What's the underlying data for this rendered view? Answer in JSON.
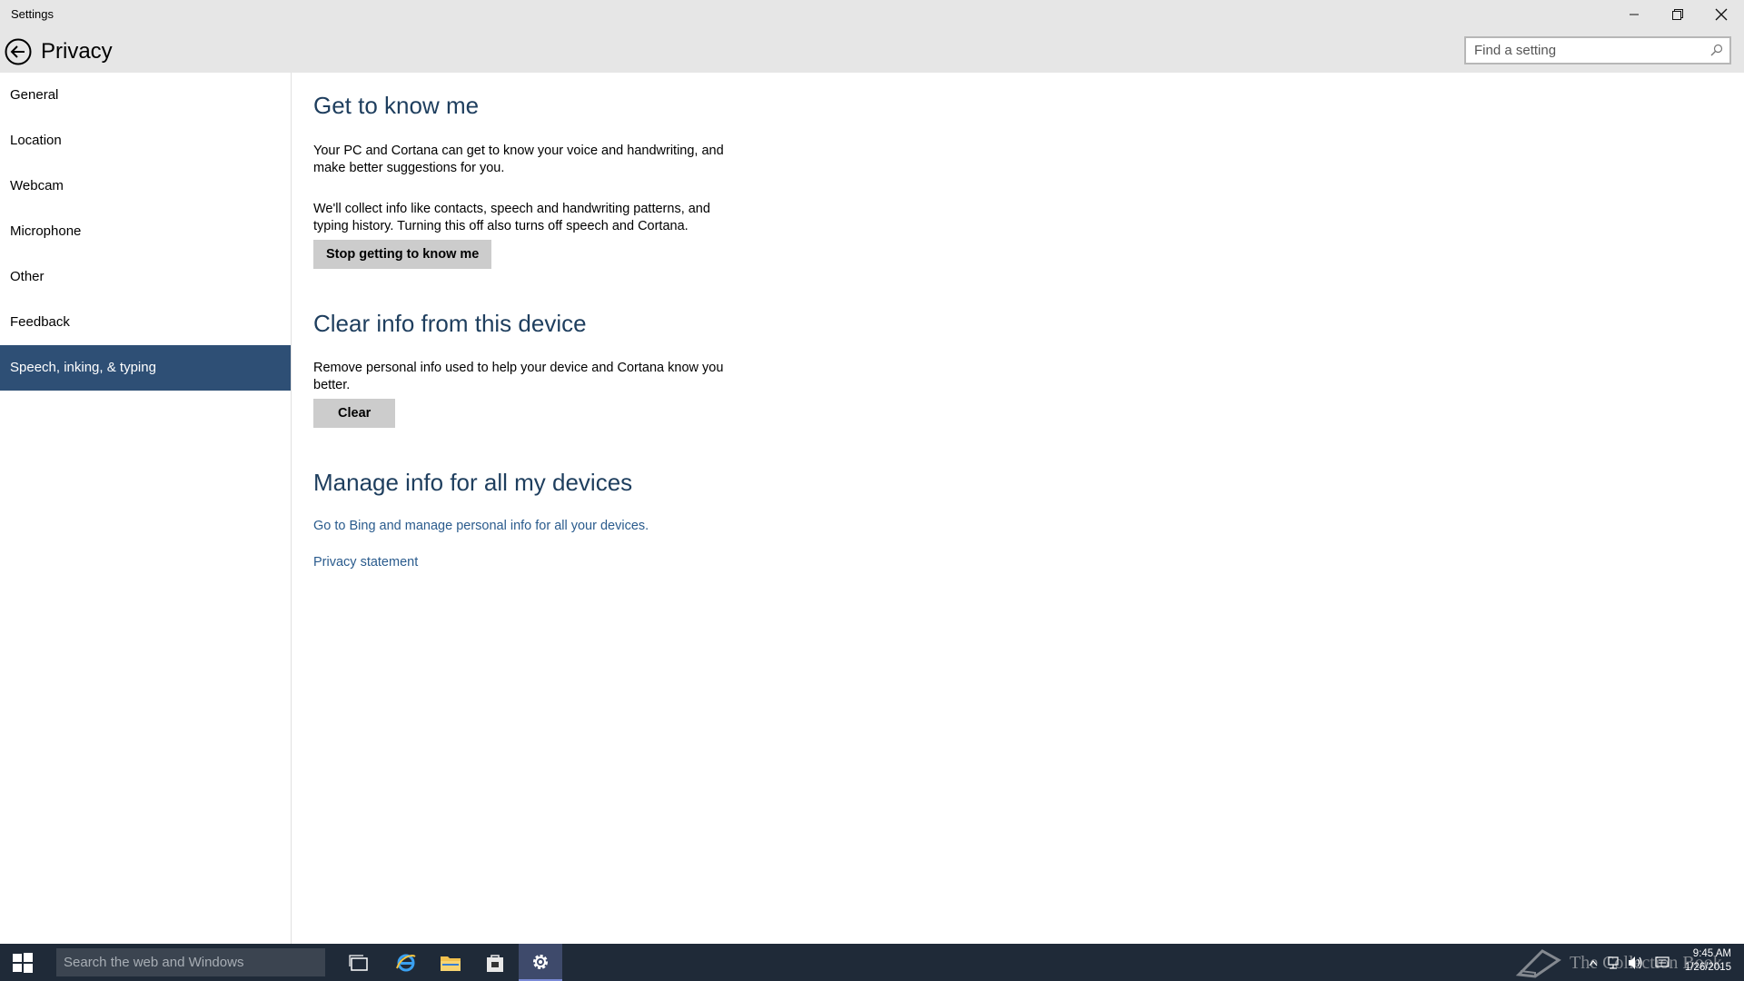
{
  "window": {
    "title": "Settings"
  },
  "header": {
    "title": "Privacy",
    "search_placeholder": "Find a setting"
  },
  "sidebar": {
    "items": [
      {
        "label": "General"
      },
      {
        "label": "Location"
      },
      {
        "label": "Webcam"
      },
      {
        "label": "Microphone"
      },
      {
        "label": "Other"
      },
      {
        "label": "Feedback"
      },
      {
        "label": "Speech, inking, & typing",
        "selected": true
      }
    ]
  },
  "main": {
    "know_me": {
      "heading": "Get to know me",
      "para1": "Your PC and Cortana can get to know your voice and handwriting, and make better suggestions for you.",
      "para2": "We'll collect info like contacts, speech and handwriting patterns, and typing history. Turning this off also turns off speech and Cortana.",
      "button": "Stop getting to know me"
    },
    "clear": {
      "heading": "Clear info from this device",
      "para": "Remove personal info used to help your device and Cortana know you better.",
      "button": "Clear"
    },
    "manage": {
      "heading": "Manage info for all my devices",
      "link_bing": "Go to Bing and manage personal info for all your devices.",
      "link_privacy": "Privacy statement"
    }
  },
  "taskbar": {
    "search_placeholder": "Search the web and Windows",
    "watermark": "The Collection Book",
    "time": "9:45 AM",
    "date": "1/26/2015"
  },
  "colors": {
    "selected_nav": "#2e4f75",
    "heading": "#1e3e5e",
    "link": "#2a5b8d",
    "taskbar": "#1f2a38",
    "titlebar": "#e6e6e6"
  },
  "icons": [
    "back-arrow-icon",
    "minimize-icon",
    "maximize-icon",
    "close-icon",
    "search-icon",
    "windows-start-icon",
    "task-view-icon",
    "internet-explorer-icon",
    "file-explorer-icon",
    "store-icon",
    "settings-gear-icon",
    "notification-icon",
    "network-icon",
    "volume-icon",
    "action-center-icon"
  ]
}
